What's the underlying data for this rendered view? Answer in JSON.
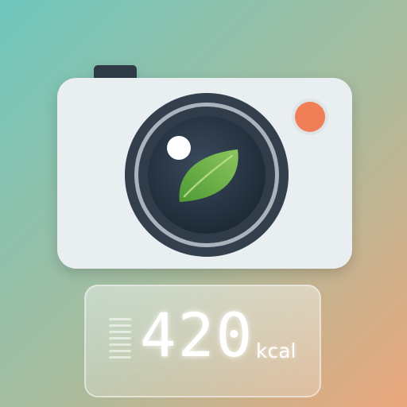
{
  "display": {
    "value": "420",
    "unit": "kcal"
  },
  "icons": {
    "camera": "camera-icon",
    "lens": "camera-lens-icon",
    "leaf": "leaf-icon",
    "record_indicator": "record-dot-icon",
    "level_meter": "level-bars-icon"
  },
  "colors": {
    "background_start": "#6fc7bd",
    "background_end": "#eba77c",
    "camera_body": "#e9eef0",
    "lens_ring": "#333f4d",
    "leaf": "#6bb24a",
    "record_dot": "#f07f57"
  }
}
